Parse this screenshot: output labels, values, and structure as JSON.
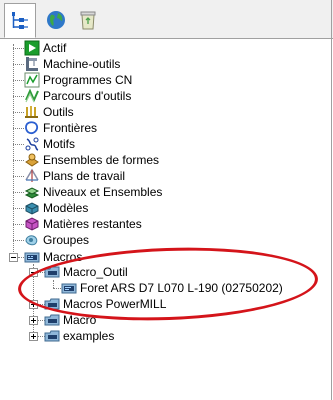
{
  "tree": {
    "items": [
      {
        "label": "Actif",
        "icon": "play-arrow-icon"
      },
      {
        "label": "Machine-outils",
        "icon": "machine-tool-icon"
      },
      {
        "label": "Programmes CN",
        "icon": "nc-program-icon"
      },
      {
        "label": "Parcours d'outils",
        "icon": "toolpath-icon"
      },
      {
        "label": "Outils",
        "icon": "tools-icon"
      },
      {
        "label": "Frontières",
        "icon": "boundary-icon"
      },
      {
        "label": "Motifs",
        "icon": "pattern-icon"
      },
      {
        "label": "Ensembles de formes",
        "icon": "feature-sets-icon"
      },
      {
        "label": "Plans de travail",
        "icon": "workplane-icon"
      },
      {
        "label": "Niveaux et Ensembles",
        "icon": "levels-icon"
      },
      {
        "label": "Modèles",
        "icon": "model-icon"
      },
      {
        "label": "Matières restantes",
        "icon": "stock-model-icon"
      },
      {
        "label": "Groupes",
        "icon": "groups-icon"
      },
      {
        "label": "Macros",
        "icon": "macro-folder-icon"
      }
    ],
    "macros": {
      "macro_outil": {
        "label": "Macro_Outil"
      },
      "foret": {
        "label": "Foret ARS D7 L070 L-190 (02750202)"
      },
      "powermill": {
        "label": "Macros PowerMILL"
      },
      "macro": {
        "label": "Macro"
      },
      "examples": {
        "label": "examples"
      }
    }
  },
  "colors": {
    "annotation": "#d4141a",
    "active_green": "#1a9d2c"
  }
}
